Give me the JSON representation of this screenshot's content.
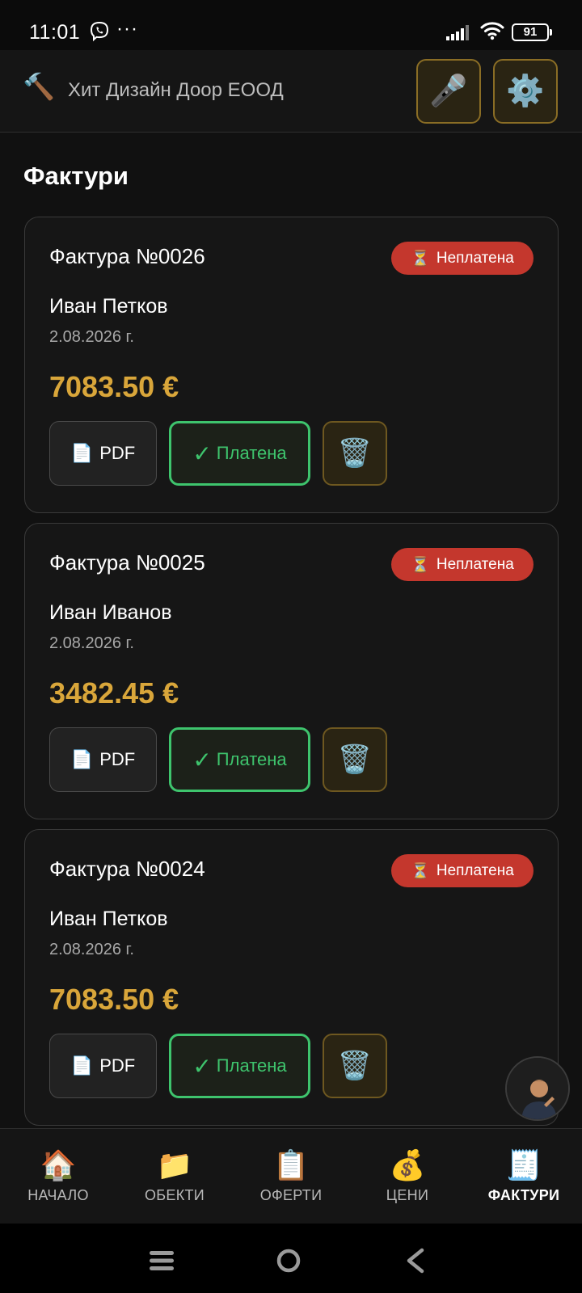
{
  "status_bar": {
    "time": "11:01",
    "dots": "···",
    "battery": "91"
  },
  "header": {
    "logo_icon": "hammer-icon",
    "logo_glyph": "🔨",
    "title": "Хит Дизайн Доор ЕООД",
    "mic_glyph": "🎤",
    "settings_glyph": "⚙️"
  },
  "page": {
    "title": "Фактури"
  },
  "invoices": [
    {
      "title": "Фактура №0026",
      "status": "Неплатена",
      "client": "Иван Петков",
      "date": "2.08.2026 г.",
      "amount": "7083.50 €"
    },
    {
      "title": "Фактура №0025",
      "status": "Неплатена",
      "client": "Иван Иванов",
      "date": "2.08.2026 г.",
      "amount": "3482.45 €"
    },
    {
      "title": "Фактура №0024",
      "status": "Неплатена",
      "client": "Иван Петков",
      "date": "2.08.2026 г.",
      "amount": "7083.50 €"
    }
  ],
  "card_actions": {
    "pdf_label": "PDF",
    "pdf_glyph": "📄",
    "paid_label": "Платена",
    "paid_glyph": "✓",
    "delete_glyph": "🗑️",
    "badge_glyph": "⏳"
  },
  "nav": [
    {
      "label": "НАЧАЛО",
      "glyph": "🏠",
      "icon": "home-icon"
    },
    {
      "label": "ОБЕКТИ",
      "glyph": "📁",
      "icon": "folder-icon"
    },
    {
      "label": "ОФЕРТИ",
      "glyph": "📋",
      "icon": "clipboard-icon"
    },
    {
      "label": "ЦЕНИ",
      "glyph": "💰",
      "icon": "money-bag-icon"
    },
    {
      "label": "ФАКТУРИ",
      "glyph": "🧾",
      "icon": "receipt-icon",
      "active": true
    }
  ],
  "colors": {
    "accent_gold": "#d9a63a",
    "paid_green": "#3ec46d",
    "unpaid_red": "#c4372d",
    "background": "#111111"
  }
}
